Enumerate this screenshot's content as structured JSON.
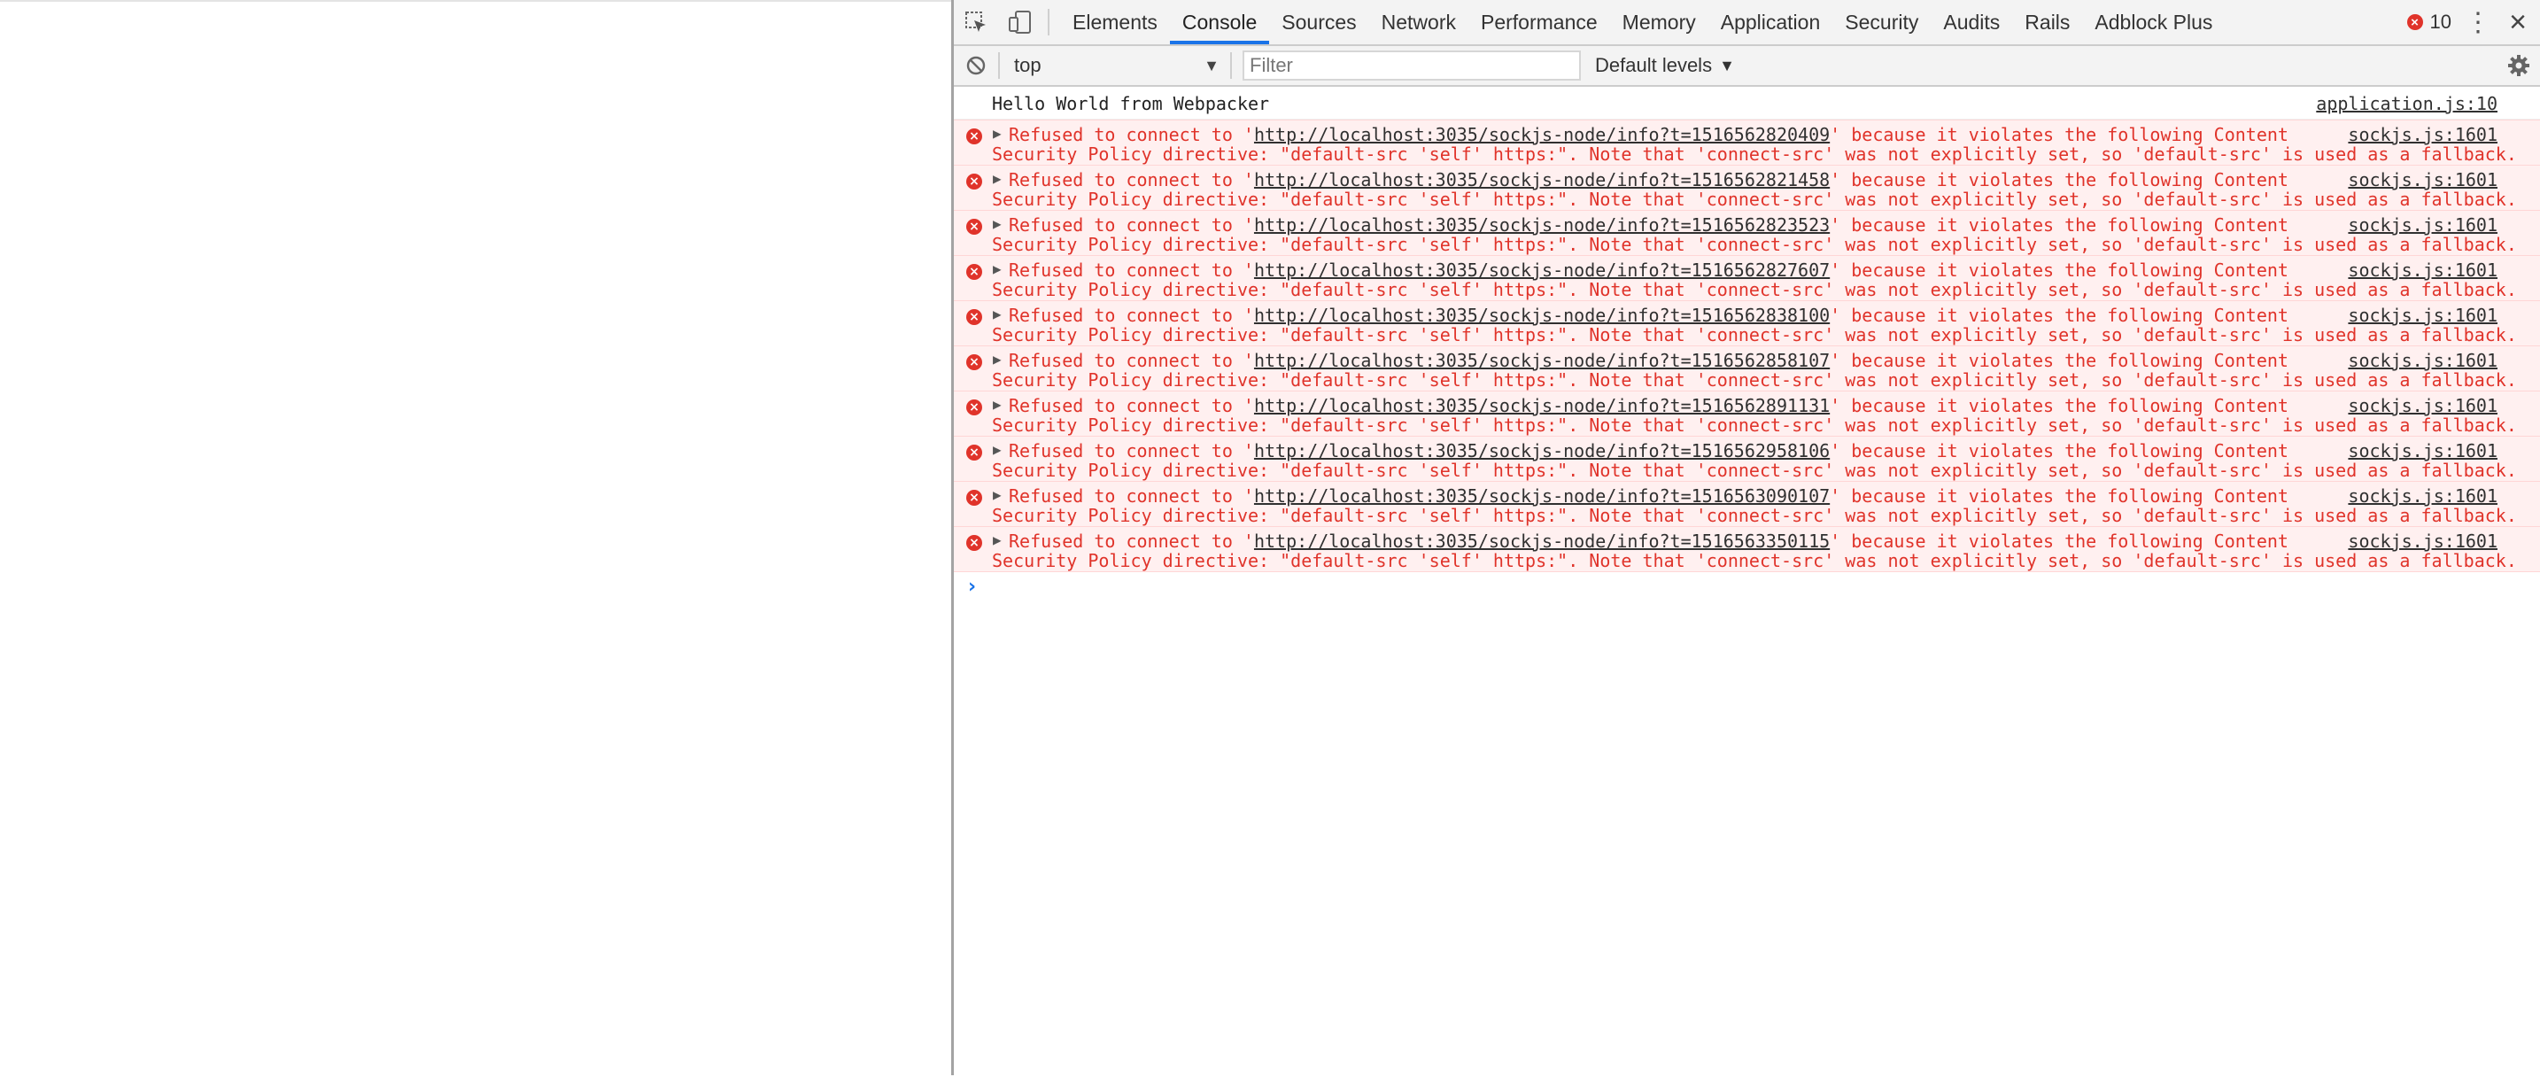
{
  "devtools": {
    "tabs": [
      {
        "label": "Elements"
      },
      {
        "label": "Console"
      },
      {
        "label": "Sources"
      },
      {
        "label": "Network"
      },
      {
        "label": "Performance"
      },
      {
        "label": "Memory"
      },
      {
        "label": "Application"
      },
      {
        "label": "Security"
      },
      {
        "label": "Audits"
      },
      {
        "label": "Rails"
      },
      {
        "label": "Adblock Plus"
      }
    ],
    "active_tab": "Console",
    "error_count": "10",
    "accent_color": "#1a73e8",
    "error_color": "#e0332a"
  },
  "toolbar": {
    "context": "top",
    "filter_placeholder": "Filter",
    "levels": "Default levels"
  },
  "console": {
    "log": {
      "text": "Hello World from Webpacker",
      "source": "application.js:10"
    },
    "errors": [
      {
        "prefix": "Refused to connect to '",
        "url": "http://localhost:3035/sockjs-node/info?t=1516562820409",
        "suffix": "' because it violates the following Content",
        "line2": "Security Policy directive: \"default-src 'self' https:\". Note that 'connect-src' was not explicitly set, so 'default-src' is used as a fallback.",
        "source": "sockjs.js:1601"
      },
      {
        "prefix": "Refused to connect to '",
        "url": "http://localhost:3035/sockjs-node/info?t=1516562821458",
        "suffix": "' because it violates the following Content",
        "line2": "Security Policy directive: \"default-src 'self' https:\". Note that 'connect-src' was not explicitly set, so 'default-src' is used as a fallback.",
        "source": "sockjs.js:1601"
      },
      {
        "prefix": "Refused to connect to '",
        "url": "http://localhost:3035/sockjs-node/info?t=1516562823523",
        "suffix": "' because it violates the following Content",
        "line2": "Security Policy directive: \"default-src 'self' https:\". Note that 'connect-src' was not explicitly set, so 'default-src' is used as a fallback.",
        "source": "sockjs.js:1601"
      },
      {
        "prefix": "Refused to connect to '",
        "url": "http://localhost:3035/sockjs-node/info?t=1516562827607",
        "suffix": "' because it violates the following Content",
        "line2": "Security Policy directive: \"default-src 'self' https:\". Note that 'connect-src' was not explicitly set, so 'default-src' is used as a fallback.",
        "source": "sockjs.js:1601"
      },
      {
        "prefix": "Refused to connect to '",
        "url": "http://localhost:3035/sockjs-node/info?t=1516562838100",
        "suffix": "' because it violates the following Content",
        "line2": "Security Policy directive: \"default-src 'self' https:\". Note that 'connect-src' was not explicitly set, so 'default-src' is used as a fallback.",
        "source": "sockjs.js:1601"
      },
      {
        "prefix": "Refused to connect to '",
        "url": "http://localhost:3035/sockjs-node/info?t=1516562858107",
        "suffix": "' because it violates the following Content",
        "line2": "Security Policy directive: \"default-src 'self' https:\". Note that 'connect-src' was not explicitly set, so 'default-src' is used as a fallback.",
        "source": "sockjs.js:1601"
      },
      {
        "prefix": "Refused to connect to '",
        "url": "http://localhost:3035/sockjs-node/info?t=1516562891131",
        "suffix": "' because it violates the following Content",
        "line2": "Security Policy directive: \"default-src 'self' https:\". Note that 'connect-src' was not explicitly set, so 'default-src' is used as a fallback.",
        "source": "sockjs.js:1601"
      },
      {
        "prefix": "Refused to connect to '",
        "url": "http://localhost:3035/sockjs-node/info?t=1516562958106",
        "suffix": "' because it violates the following Content",
        "line2": "Security Policy directive: \"default-src 'self' https:\". Note that 'connect-src' was not explicitly set, so 'default-src' is used as a fallback.",
        "source": "sockjs.js:1601"
      },
      {
        "prefix": "Refused to connect to '",
        "url": "http://localhost:3035/sockjs-node/info?t=1516563090107",
        "suffix": "' because it violates the following Content",
        "line2": "Security Policy directive: \"default-src 'self' https:\". Note that 'connect-src' was not explicitly set, so 'default-src' is used as a fallback.",
        "source": "sockjs.js:1601"
      },
      {
        "prefix": "Refused to connect to '",
        "url": "http://localhost:3035/sockjs-node/info?t=1516563350115",
        "suffix": "' because it violates the following Content",
        "line2": "Security Policy directive: \"default-src 'self' https:\". Note that 'connect-src' was not explicitly set, so 'default-src' is used as a fallback.",
        "source": "sockjs.js:1601"
      }
    ]
  }
}
